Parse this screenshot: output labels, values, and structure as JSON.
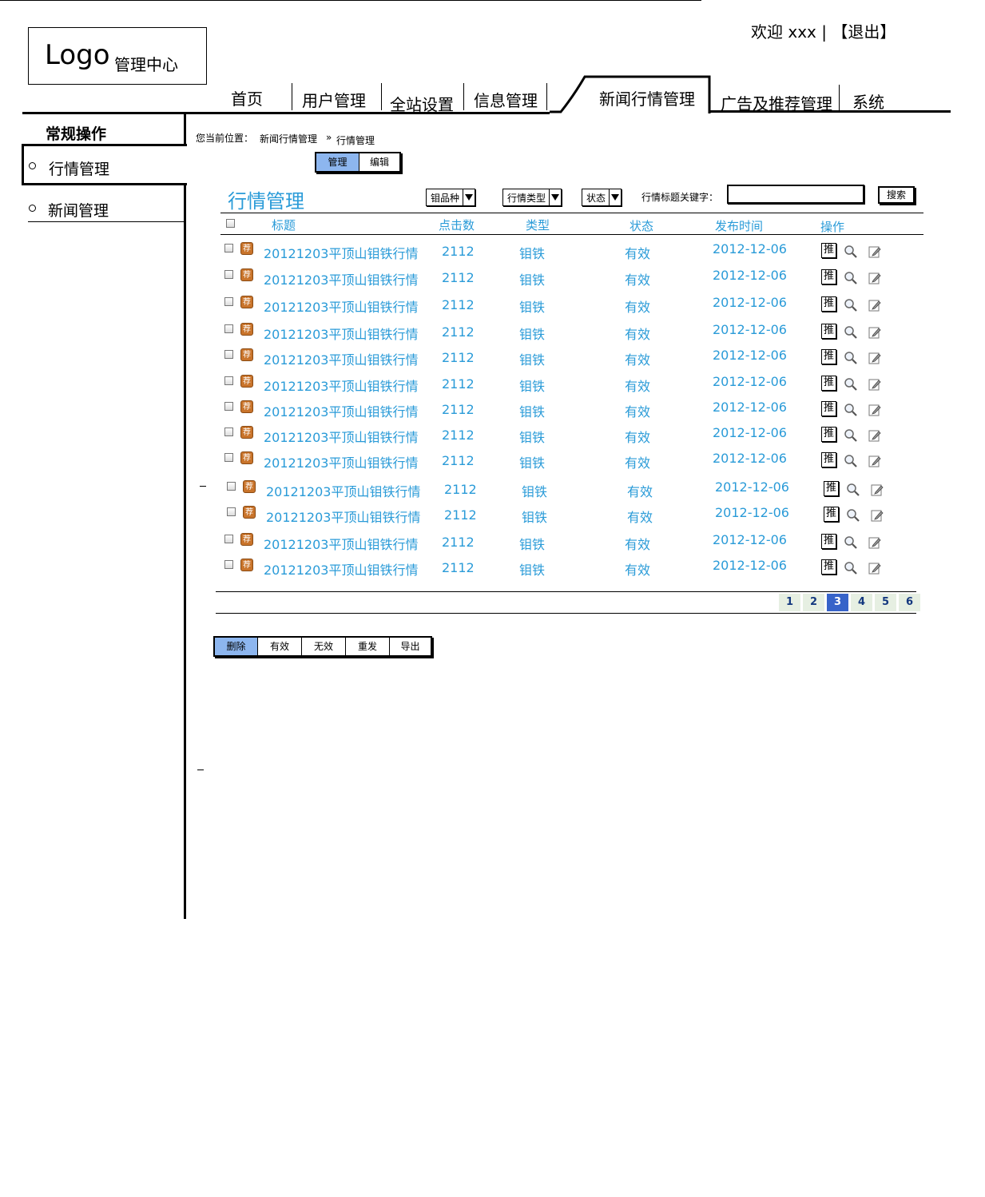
{
  "header": {
    "logo": "Logo",
    "logo_subtitle": "管理中心",
    "welcome": "欢迎 xxx | 【退出】"
  },
  "nav": {
    "items": [
      {
        "label": "首页"
      },
      {
        "label": "用户管理"
      },
      {
        "label": "全站设置"
      },
      {
        "label": "信息管理"
      },
      {
        "label": "新闻行情管理",
        "active": true
      },
      {
        "label": "广告及推荐管理"
      },
      {
        "label": "系统"
      }
    ]
  },
  "sidebar": {
    "heading": "常规操作",
    "items": [
      {
        "label": "行情管理",
        "active": true
      },
      {
        "label": "新闻管理"
      }
    ]
  },
  "breadcrumb": {
    "prefix": "您当前位置：",
    "parent": "新闻行情管理",
    "separator": "»",
    "current": "行情管理"
  },
  "mode_tabs": {
    "manage": "管理",
    "edit": "编辑"
  },
  "main": {
    "title": "行情管理"
  },
  "filters": {
    "variety": "钼品种",
    "type": "行情类型",
    "status": "状态",
    "keyword_label": "行情标题关键字：",
    "keyword_value": "",
    "search_button": "搜索"
  },
  "table": {
    "columns": [
      "标题",
      "点击数",
      "类型",
      "状态",
      "发布时间",
      "操作"
    ],
    "recommend_badge": "荐",
    "push_label": "推",
    "rows": [
      {
        "title": "20121203平顶山钼铁行情",
        "clicks": "2112",
        "type": "钼铁",
        "status": "有效",
        "date": "2012-12-06"
      },
      {
        "title": "20121203平顶山钼铁行情",
        "clicks": "2112",
        "type": "钼铁",
        "status": "有效",
        "date": "2012-12-06"
      },
      {
        "title": "20121203平顶山钼铁行情",
        "clicks": "2112",
        "type": "钼铁",
        "status": "有效",
        "date": "2012-12-06"
      },
      {
        "title": "20121203平顶山钼铁行情",
        "clicks": "2112",
        "type": "钼铁",
        "status": "有效",
        "date": "2012-12-06"
      },
      {
        "title": "20121203平顶山钼铁行情",
        "clicks": "2112",
        "type": "钼铁",
        "status": "有效",
        "date": "2012-12-06"
      },
      {
        "title": "20121203平顶山钼铁行情",
        "clicks": "2112",
        "type": "钼铁",
        "status": "有效",
        "date": "2012-12-06"
      },
      {
        "title": "20121203平顶山钼铁行情",
        "clicks": "2112",
        "type": "钼铁",
        "status": "有效",
        "date": "2012-12-06"
      },
      {
        "title": "20121203平顶山钼铁行情",
        "clicks": "2112",
        "type": "钼铁",
        "status": "有效",
        "date": "2012-12-06"
      },
      {
        "title": "20121203平顶山钼铁行情",
        "clicks": "2112",
        "type": "钼铁",
        "status": "有效",
        "date": "2012-12-06"
      },
      {
        "title": "20121203平顶山钼铁行情",
        "clicks": "2112",
        "type": "钼铁",
        "status": "有效",
        "date": "2012-12-06"
      },
      {
        "title": "20121203平顶山钼铁行情",
        "clicks": "2112",
        "type": "钼铁",
        "status": "有效",
        "date": "2012-12-06"
      },
      {
        "title": "20121203平顶山钼铁行情",
        "clicks": "2112",
        "type": "钼铁",
        "status": "有效",
        "date": "2012-12-06"
      },
      {
        "title": "20121203平顶山钼铁行情",
        "clicks": "2112",
        "type": "钼铁",
        "status": "有效",
        "date": "2012-12-06"
      }
    ]
  },
  "pagination": {
    "pages": [
      "1",
      "2",
      "3",
      "4",
      "5",
      "6"
    ],
    "current": "3"
  },
  "actions": {
    "delete": "删除",
    "valid": "有效",
    "invalid": "无效",
    "resend": "重发",
    "export": "导出"
  }
}
